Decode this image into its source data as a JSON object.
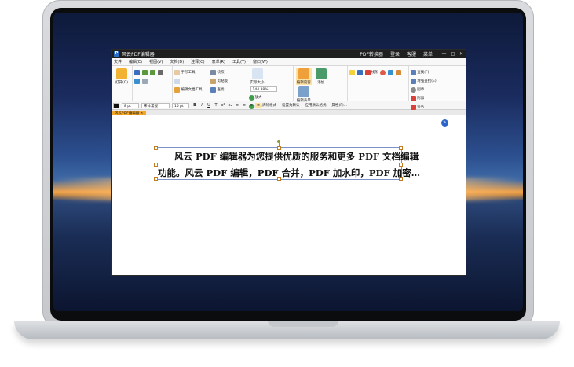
{
  "window": {
    "logo": "P",
    "title": "风云PDF编辑器",
    "links": [
      "PDF转换器",
      "登录",
      "客服",
      "菜单"
    ],
    "controls": [
      "—",
      "□",
      "✕"
    ]
  },
  "menu": [
    "文件",
    "编辑(E)",
    "视图(V)",
    "文档(D)",
    "注释(C)",
    "表单(R)",
    "工具(T)",
    "窗口(W)"
  ],
  "ribbon": {
    "open_label": "打开(O)",
    "zoom_value": "144.38%",
    "tools": [
      "手形工具",
      "快照",
      "剪贴板",
      "查找",
      "编辑文档工具",
      "实际大小",
      "放大",
      "缩小",
      "编辑内容",
      "添加",
      "编辑表单",
      "线条",
      "查找(F)",
      "增强查找(E)",
      "图章",
      "附加",
      "签名"
    ]
  },
  "format_bar": {
    "size_value": "8 pt",
    "font_value": "宋体常规",
    "font_size": "15 pt",
    "text_items": [
      "清除格式",
      "设置为默认",
      "应用默认格式",
      "属性(P)..."
    ]
  },
  "tab": {
    "label": "风云PDF编辑器"
  },
  "document": {
    "line1": "风云 PDF 编辑器为您提供优质的服务和更多 PDF 文档编辑",
    "line2": "功能。风云 PDF 编辑，PDF 合并，PDF 加水印，PDF 加密…"
  },
  "colors": {
    "accent": "#f5a623",
    "brand": "#2c6bc6",
    "selection": "#7a93c6"
  }
}
